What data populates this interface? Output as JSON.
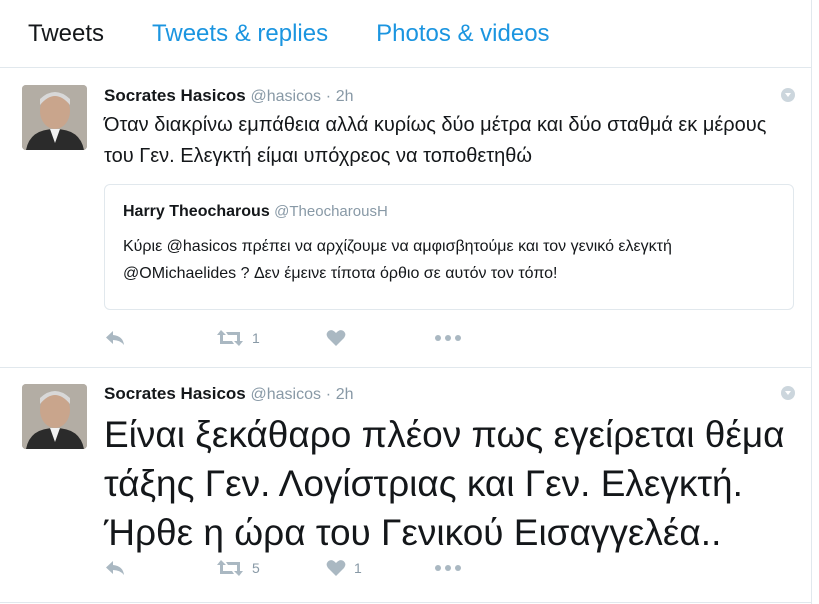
{
  "tabs": [
    {
      "label": "Tweets"
    },
    {
      "label": "Tweets & replies"
    },
    {
      "label": "Photos & videos"
    }
  ],
  "tweets": [
    {
      "name": "Socrates Hasicos",
      "handle": "@hasicos",
      "dot": "·",
      "time": "2h",
      "text": "Όταν διακρίνω εμπάθεια αλλά κυρίως δύο μέτρα και δύο σταθμά εκ μέρους του Γεν. Ελεγκτή είμαι υπόχρεος να τοποθετηθώ",
      "quote": {
        "name": "Harry Theocharous",
        "handle": "@TheocharousH",
        "text": "Κύριε @hasicos πρέπει να αρχίζουμε να αμφισβητούμε και τον γενικό ελεγκτή @OMichaelides ? Δεν έμεινε τίποτα όρθιο σε αυτόν τον τόπο!"
      },
      "retweets": "1",
      "likes": ""
    },
    {
      "name": "Socrates Hasicos",
      "handle": "@hasicos",
      "dot": "·",
      "time": "2h",
      "text": "Είναι ξεκάθαρο πλέον πως εγείρεται θέμα τάξης Γεν. Λογίστριας και Γεν. Ελεγκτή. Ήρθε η ώρα του Γενικού Εισαγγελέα..",
      "retweets": "5",
      "likes": "1"
    }
  ],
  "colors": {
    "link": "#1b95e0",
    "muted": "#8899a6",
    "icon": "#aab8c2",
    "border": "#e1e8ed"
  },
  "icons": [
    "reply-icon",
    "retweet-icon",
    "like-icon",
    "more-icon",
    "caret-down-icon"
  ]
}
